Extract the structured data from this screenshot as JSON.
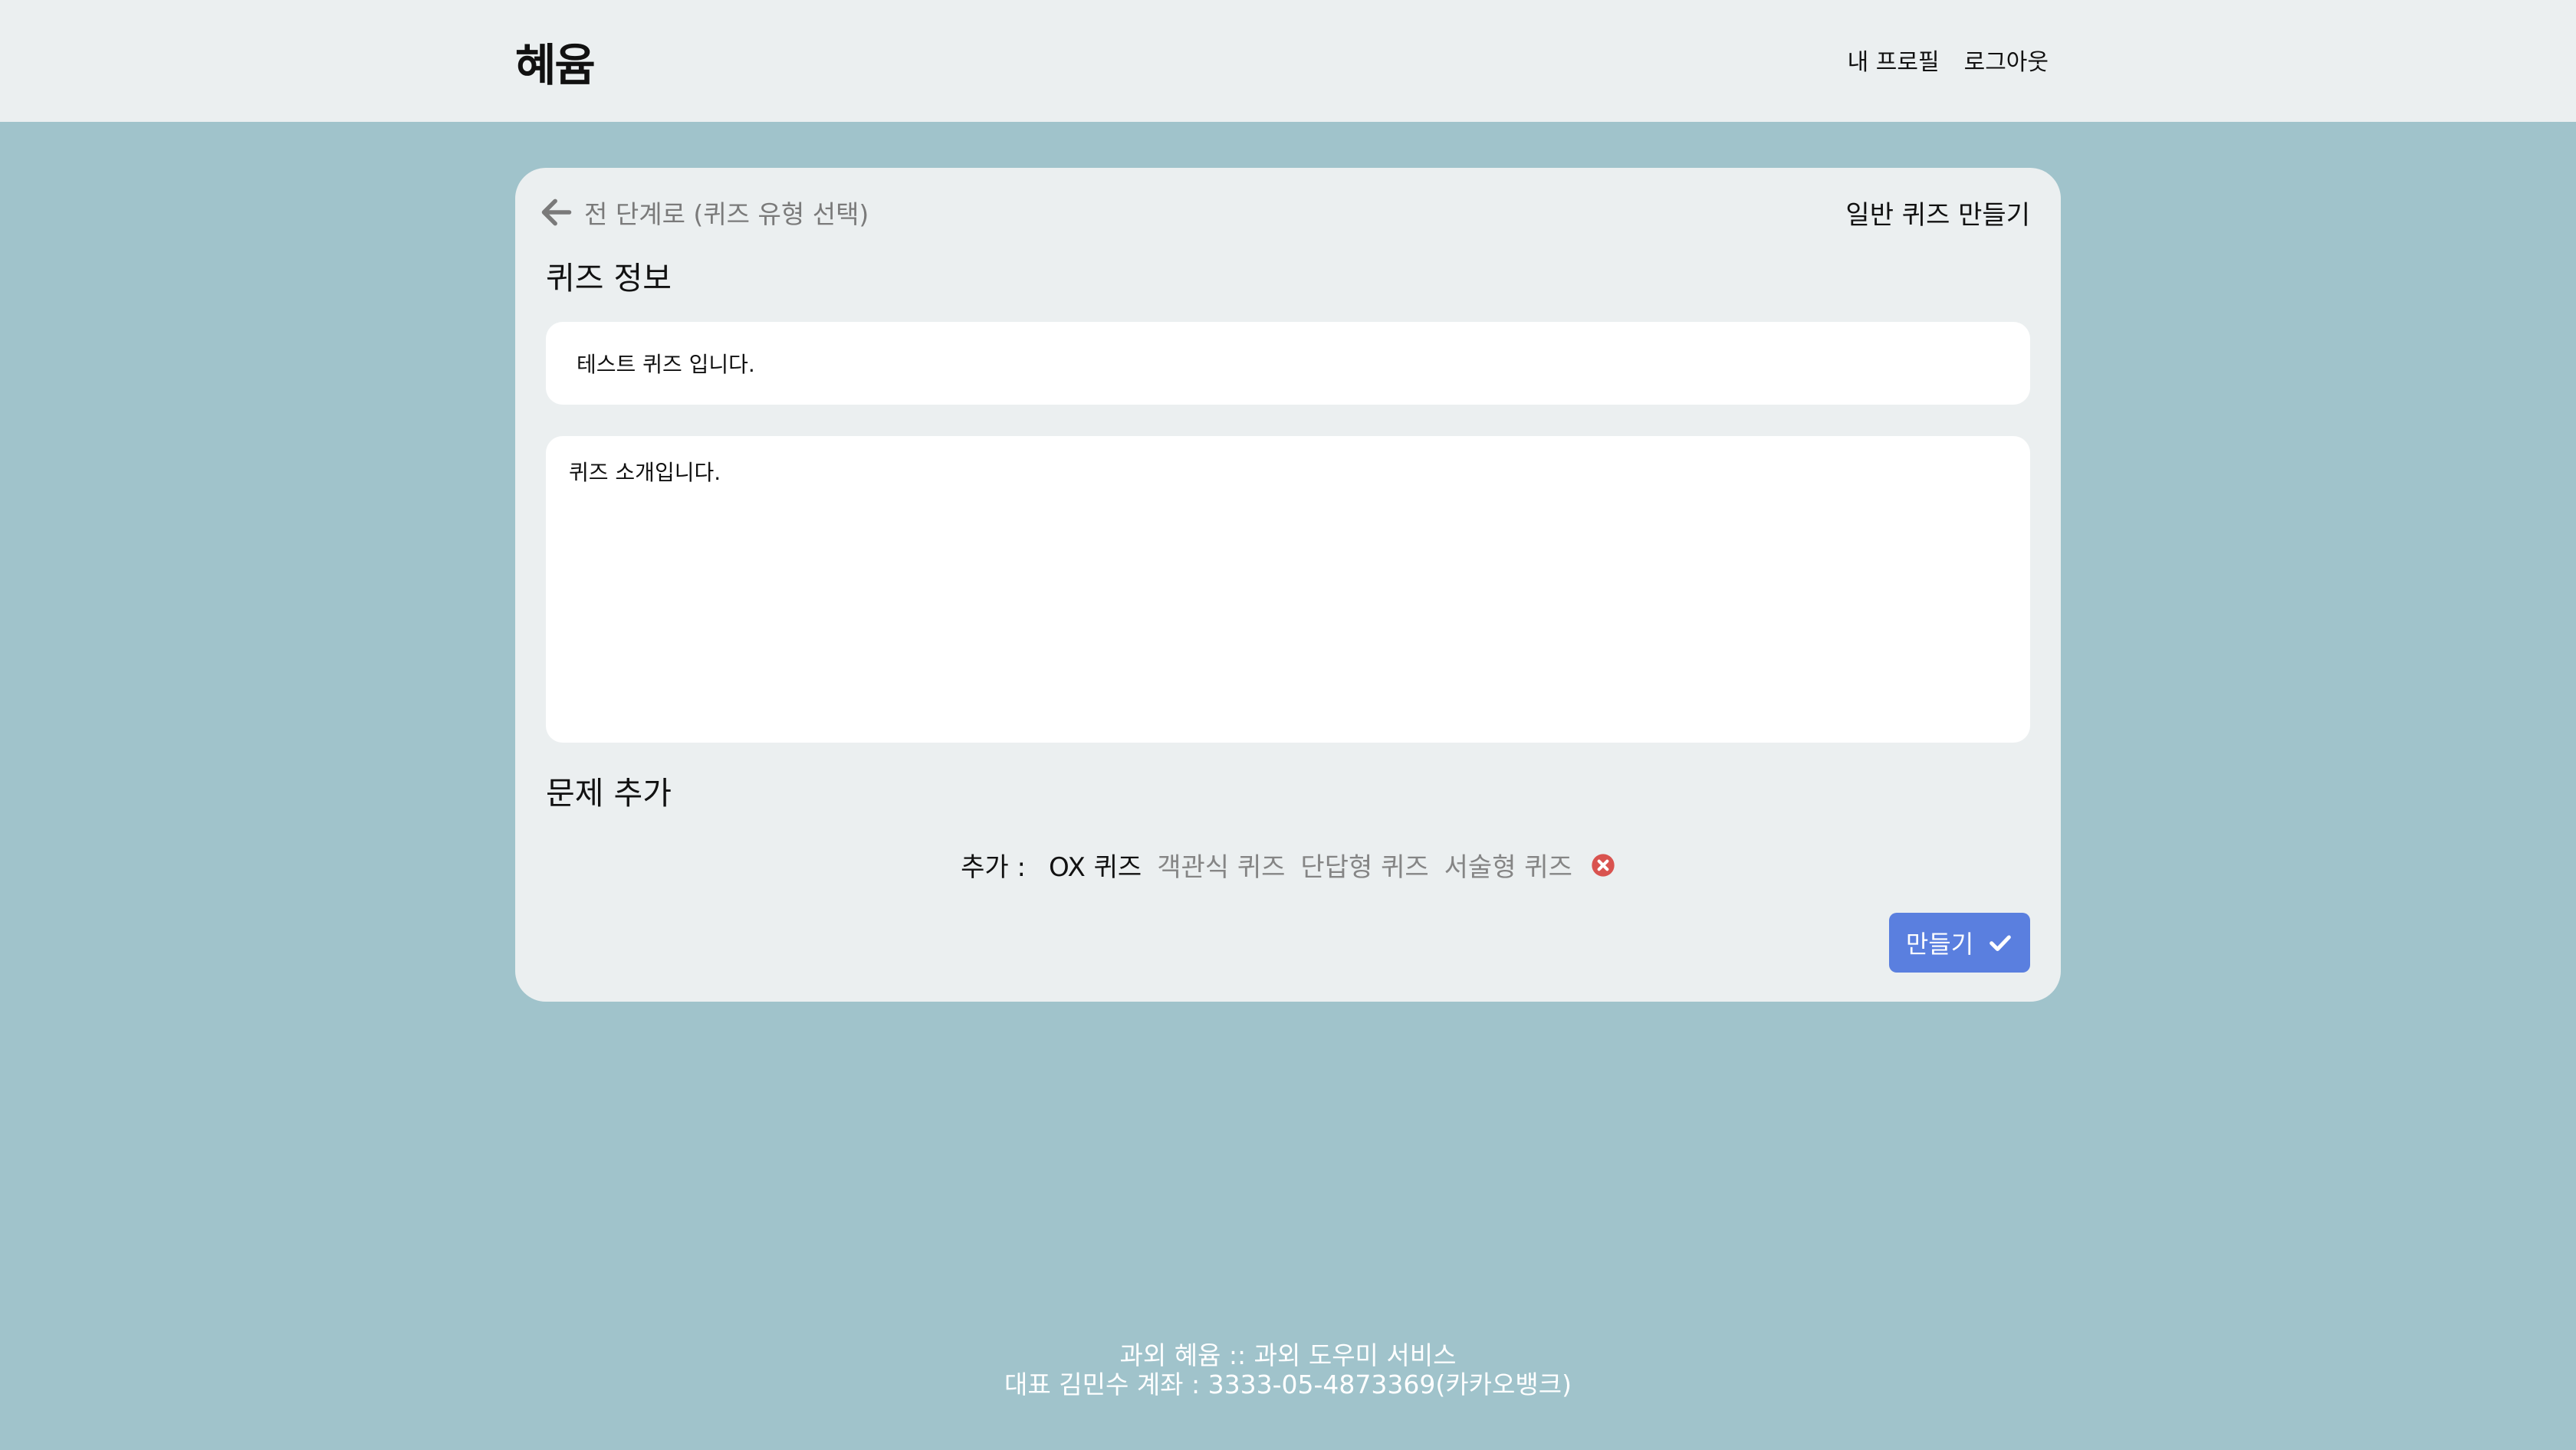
{
  "header": {
    "brand": "혜윰",
    "nav": {
      "profile": "내 프로필",
      "logout": "로그아웃"
    }
  },
  "card": {
    "back_label": "전 단계로 (퀴즈 유형 선택)",
    "title": "일반 퀴즈 만들기",
    "quiz_info_heading": "퀴즈 정보",
    "quiz_title_value": "테스트 퀴즈 입니다.",
    "quiz_description_value": "퀴즈 소개입니다.",
    "add_question_heading": "문제 추가",
    "add_label": "추가 :",
    "question_types": [
      "OX 퀴즈",
      "객관식 퀴즈",
      "단답형 퀴즈",
      "서술형 퀴즈"
    ],
    "active_type": "OX 퀴즈",
    "make_button": "만들기"
  },
  "footer": {
    "line1": "과외 혜윰 :: 과외 도우미 서비스",
    "line2": "대표 김민수 계좌 : 3333-05-4873369(카카오뱅크)"
  },
  "colors": {
    "background": "#a0c3cb",
    "surface": "#ebeff0",
    "primary_button": "#5a7fdf",
    "remove_icon": "#d9534f"
  },
  "icons": {
    "back": "arrow-left-icon",
    "remove": "circle-x-icon",
    "make": "check-icon"
  }
}
